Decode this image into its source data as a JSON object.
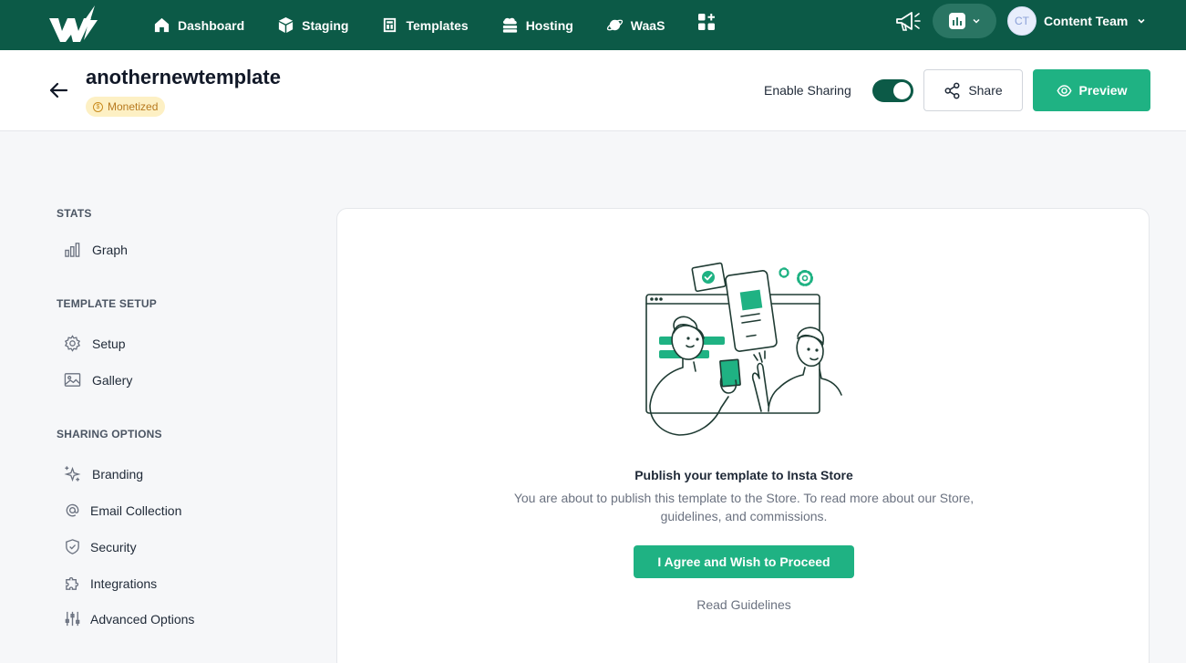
{
  "nav": {
    "items": [
      {
        "label": "Dashboard",
        "icon": "home-icon"
      },
      {
        "label": "Staging",
        "icon": "cube-icon"
      },
      {
        "label": "Templates",
        "icon": "templates-icon"
      },
      {
        "label": "Hosting",
        "icon": "cloud-server-icon"
      },
      {
        "label": "WaaS",
        "icon": "planet-icon"
      }
    ],
    "user": {
      "initials": "CT",
      "name": "Content Team"
    }
  },
  "header": {
    "title": "anothernewtemplate",
    "badge": "Monetized",
    "badge_symbol": "$",
    "enable_sharing_label": "Enable Sharing",
    "enable_sharing_on": true,
    "share_label": "Share",
    "preview_label": "Preview"
  },
  "sidebar": {
    "sections": [
      {
        "label": "STATS",
        "items": [
          {
            "label": "Graph",
            "icon": "bar-chart-icon"
          }
        ]
      },
      {
        "label": "TEMPLATE SETUP",
        "items": [
          {
            "label": "Setup",
            "icon": "gear-icon"
          },
          {
            "label": "Gallery",
            "icon": "image-icon"
          }
        ]
      },
      {
        "label": "SHARING OPTIONS",
        "items": [
          {
            "label": "Branding",
            "icon": "sparkle-icon"
          },
          {
            "label": "Email Collection",
            "icon": "at-icon"
          },
          {
            "label": "Security",
            "icon": "shield-icon"
          },
          {
            "label": "Integrations",
            "icon": "puzzle-icon"
          },
          {
            "label": "Advanced Options",
            "icon": "sliders-icon"
          }
        ]
      }
    ]
  },
  "main": {
    "title": "Publish your template to Insta Store",
    "description": "You are about to publish this template to the Store. To read more about our Store, guidelines, and commissions.",
    "agree_label": "I Agree and Wish to Proceed",
    "guidelines_label": "Read Guidelines"
  },
  "colors": {
    "nav_bg": "#0c5a47",
    "accent": "#1fb283",
    "badge_bg": "#fdf0c4",
    "badge_text": "#b7791f"
  }
}
